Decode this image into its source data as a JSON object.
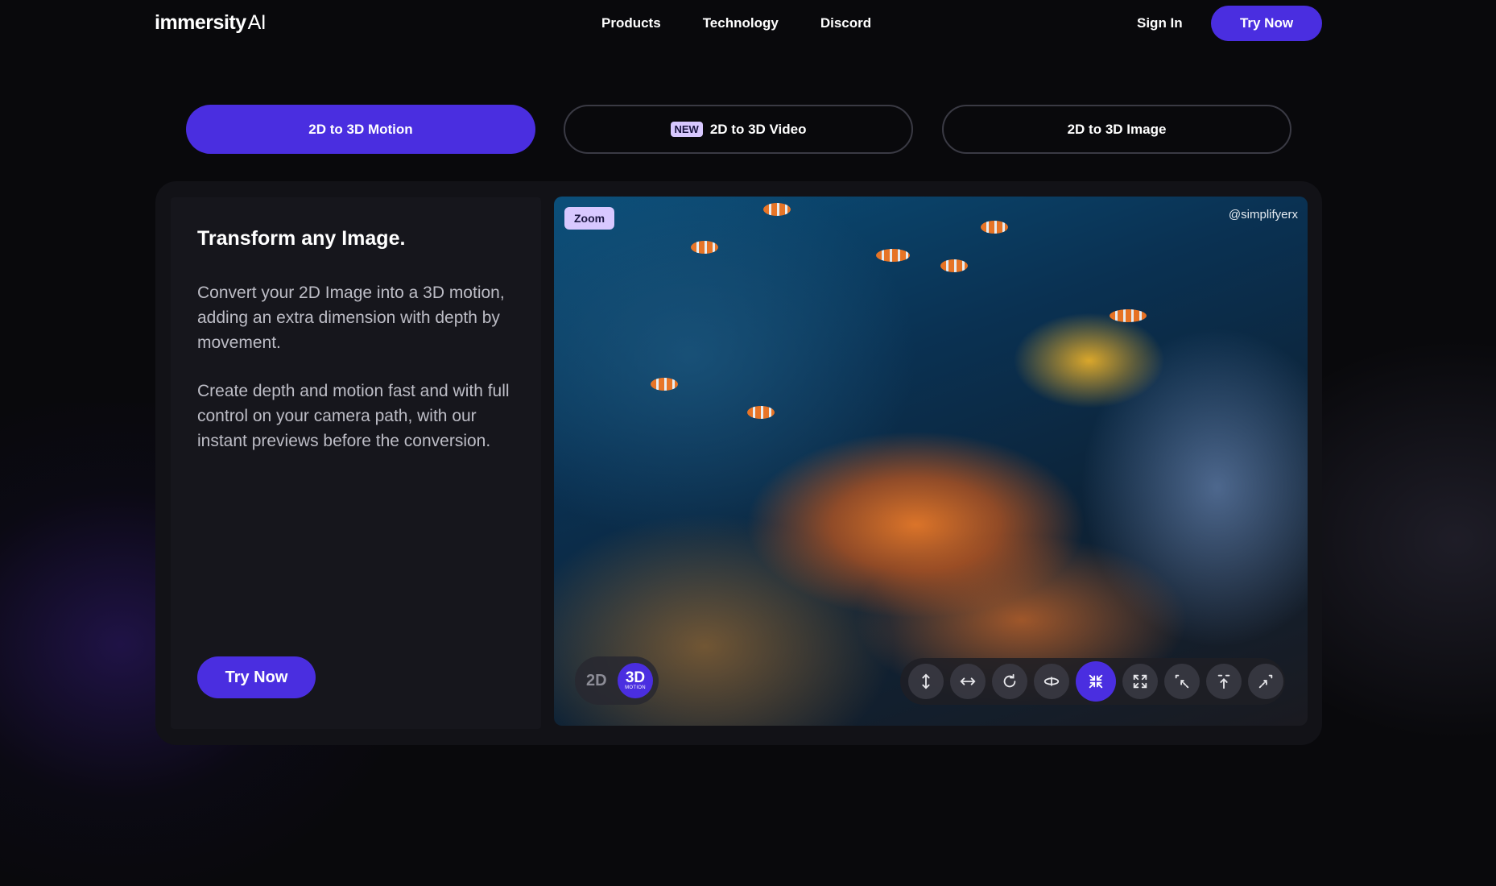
{
  "header": {
    "logo_main": "immersity",
    "logo_suffix": "AI",
    "nav": [
      "Products",
      "Technology",
      "Discord"
    ],
    "sign_in": "Sign In",
    "try_now": "Try Now"
  },
  "tabs": [
    {
      "label": "2D to 3D Motion",
      "active": true
    },
    {
      "label": "2D to 3D Video",
      "badge": "NEW"
    },
    {
      "label": "2D to 3D Image"
    }
  ],
  "content": {
    "heading": "Transform any Image.",
    "paragraph1": "Convert your 2D Image into a 3D motion, adding an extra dimension with depth by movement.",
    "paragraph2": "Create depth and motion fast and with full control on your camera path, with our instant previews before the conversion.",
    "try_now": "Try Now"
  },
  "preview": {
    "watermark": "@simplifyerx",
    "mode_badge": "Zoom",
    "toggle_2d": "2D",
    "toggle_3d": "3D",
    "toggle_3d_sub": "MOTION"
  },
  "motion_controls": [
    {
      "icon": "vertical-arrows-icon"
    },
    {
      "icon": "horizontal-arrows-icon"
    },
    {
      "icon": "circle-arrow-icon"
    },
    {
      "icon": "orbit-icon"
    },
    {
      "icon": "zoom-in-arrows-icon",
      "active": true
    },
    {
      "icon": "zoom-out-arrows-icon"
    },
    {
      "icon": "dolly-left-icon"
    },
    {
      "icon": "dolly-up-icon"
    },
    {
      "icon": "dolly-right-icon"
    }
  ],
  "colors": {
    "accent": "#4a2ee0",
    "badge": "#d8c8ff",
    "background": "#09090c"
  }
}
